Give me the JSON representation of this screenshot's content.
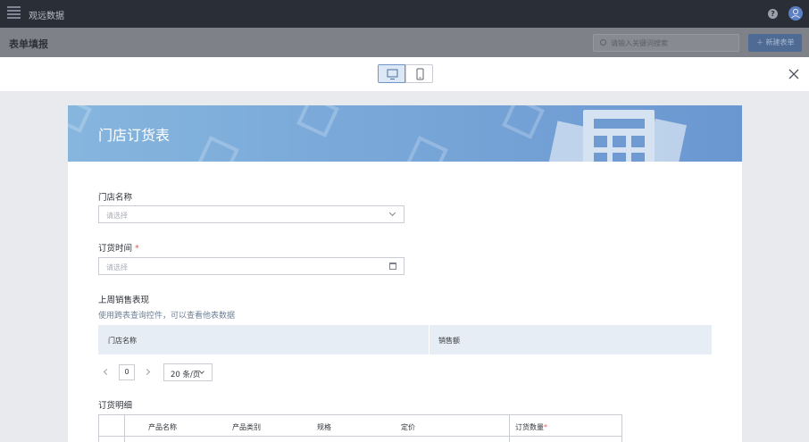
{
  "app": {
    "name": "观远数据",
    "logo_icon": "menu-logo-icon",
    "help_icon": "help-icon",
    "avatar_icon": "user-avatar-icon"
  },
  "header": {
    "title": "表单填报",
    "search_placeholder": "请输入关键词搜索",
    "new_button": "新建表单"
  },
  "preview": {
    "desktop_icon": "desktop-icon",
    "mobile_icon": "mobile-icon",
    "close_icon": "close-icon"
  },
  "form": {
    "title": "门店订货表",
    "fields": [
      {
        "label": "门店名称",
        "placeholder": "请选择",
        "required": false
      },
      {
        "label": "订货时间",
        "placeholder": "请选择",
        "required": true,
        "required_mark": "*"
      }
    ],
    "sales_section": {
      "label": "上周销售表现",
      "hint": "使用跨表查询控件，可以查看他表数据",
      "columns": [
        "门店名称",
        "销售额"
      ],
      "page": "0",
      "page_size": "20 条/页"
    },
    "detail_section": {
      "label": "订货明细",
      "columns": [
        "产品名称",
        "产品类别",
        "规格",
        "定价",
        "订货数量"
      ],
      "required_mark": "*"
    }
  },
  "colors": {
    "accent": "#5b8fd4",
    "banner_start": "#86b6de",
    "banner_end": "#6b97d1",
    "required": "#e05a4f"
  }
}
